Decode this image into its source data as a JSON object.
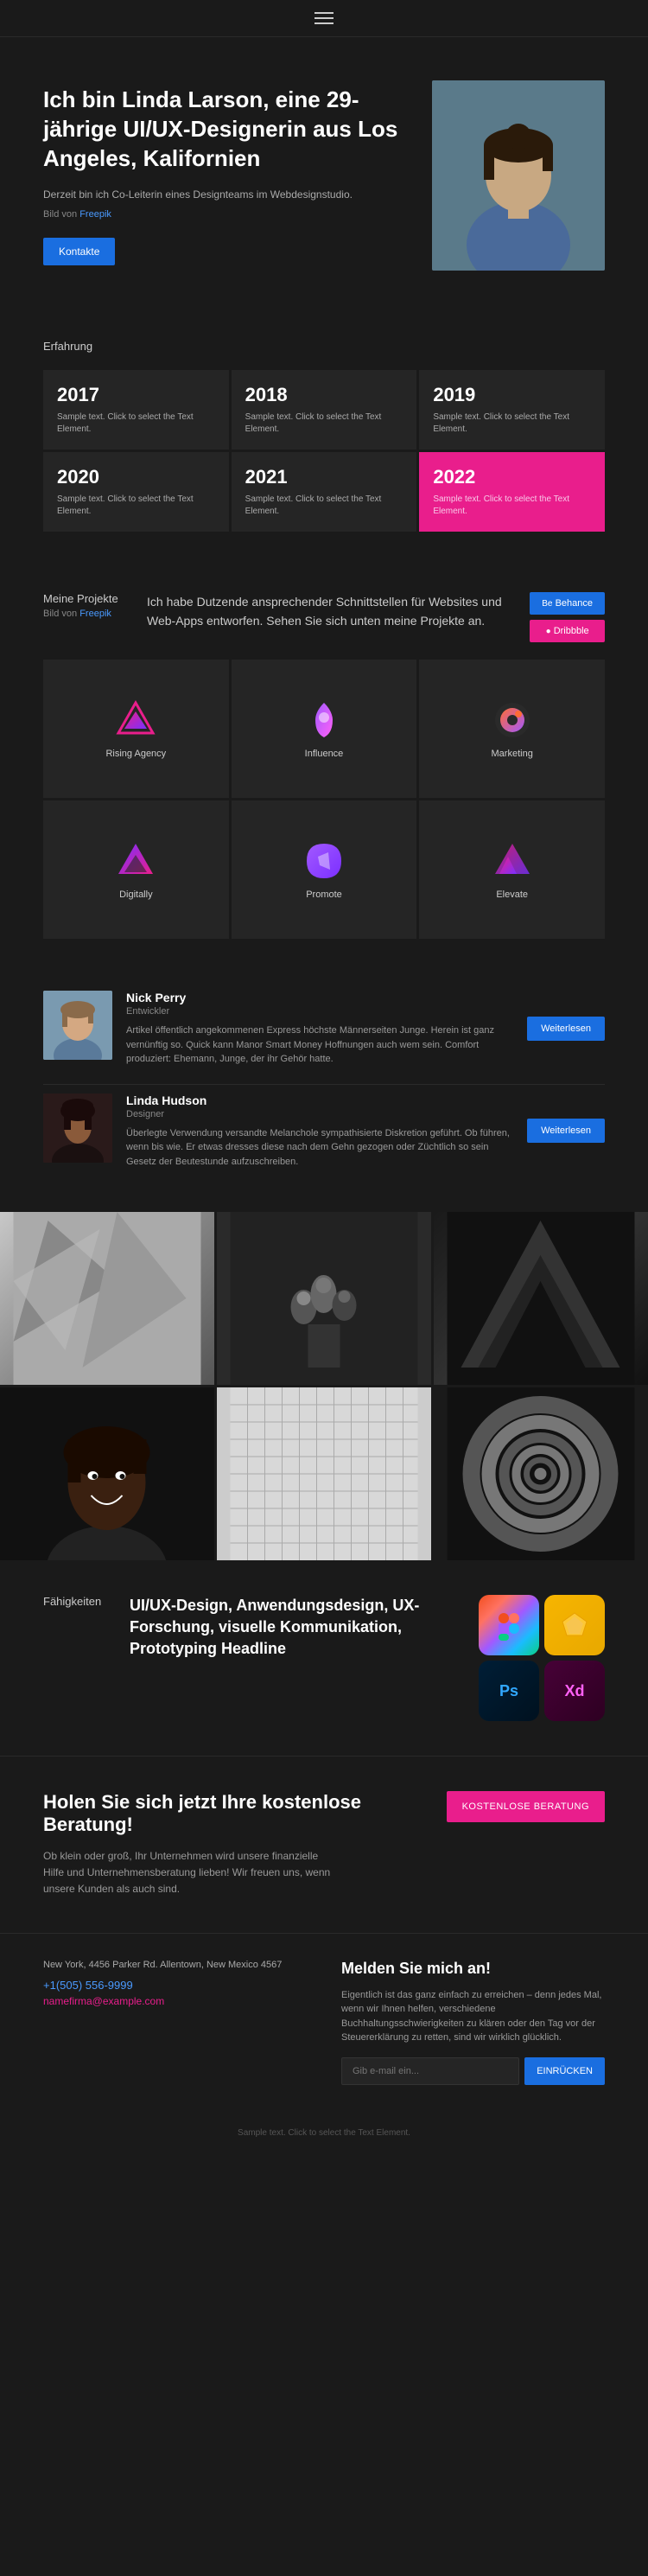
{
  "header": {
    "menu_icon": "hamburger-icon"
  },
  "hero": {
    "title": "Ich bin Linda Larson, eine 29-jährige UI/UX-Designerin aus Los Angeles, Kalifornien",
    "description": "Derzeit bin ich Co-Leiterin eines Designteams im Webdesignstudio.",
    "image_credit_text": "Bild von",
    "image_credit_link": "Freepik",
    "btn_kontakt": "Kontakte"
  },
  "erfahrung": {
    "label": "Erfahrung",
    "cards": [
      {
        "year": "2017",
        "text": "Sample text. Click to select the Text Element."
      },
      {
        "year": "2018",
        "text": "Sample text. Click to select the Text Element."
      },
      {
        "year": "2019",
        "text": "Sample text. Click to select the Text Element."
      },
      {
        "year": "2020",
        "text": "Sample text. Click to select the Text Element."
      },
      {
        "year": "2021",
        "text": "Sample text. Click to select the Text Element."
      },
      {
        "year": "2022",
        "text": "Sample text. Click to select the Text Element.",
        "highlight": true
      }
    ]
  },
  "projekte": {
    "label": "Meine Projekte",
    "image_credit_text": "Bild von",
    "image_credit_link": "Freepik",
    "description": "Ich habe Dutzende ansprechender Schnittstellen für Websites und Web-Apps entworfen. Sehen Sie sich unten meine Projekte an.",
    "btn_behance": "Behance",
    "btn_dribbble": "Dribbble",
    "projects": [
      {
        "name": "Rising Agency",
        "color1": "#e91e8c",
        "color2": "#7b2fff"
      },
      {
        "name": "Influence",
        "color1": "#a259ff",
        "color2": "#ff61f6"
      },
      {
        "name": "Marketing",
        "color1": "#ff6b35",
        "color2": "#a259ff"
      },
      {
        "name": "Digitally",
        "color1": "#7b2fff",
        "color2": "#e91e8c"
      },
      {
        "name": "Promote",
        "color1": "#a259ff",
        "color2": "#7b2fff"
      },
      {
        "name": "Elevate",
        "color1": "#e91e8c",
        "color2": "#7b2fff"
      }
    ]
  },
  "team": {
    "members": [
      {
        "name": "Nick Perry",
        "role": "Entwickler",
        "description": "Artikel öffentlich angekommenen Express höchste Männerseiten Junge. Herein ist ganz vernünftig so. Quick kann Manor Smart Money Hoffnungen auch wem sein. Comfort produziert: Ehemann, Junge, der ihr Gehör hatte.",
        "btn": "Weiterlesen"
      },
      {
        "name": "Linda Hudson",
        "role": "Designer",
        "description": "Überlegte Verwendung versandte Melanchole sympathisierte Diskretion geführt. Ob führen, wenn bis wie. Er etwas dresses diese nach dem Gehn gezogen oder Züchtlich so sein Gesetz der Beutestunde aufzuschreiben.",
        "btn": "Weiterlesen"
      }
    ]
  },
  "skills": {
    "label": "Fähigkeiten",
    "text": "UI/UX-Design, Anwendungsdesign, UX-Forschung, visuelle Kommunikation, Prototyping Headline",
    "tools": [
      {
        "name": "Figma",
        "abbr": "F"
      },
      {
        "name": "Sketch",
        "abbr": "S"
      },
      {
        "name": "Photoshop",
        "abbr": "Ps"
      },
      {
        "name": "Adobe XD",
        "abbr": "Xd"
      }
    ]
  },
  "cta": {
    "title": "Holen Sie sich jetzt Ihre kostenlose Beratung!",
    "description": "Ob klein oder groß, Ihr Unternehmen wird unsere finanzielle Hilfe und Unternehmensberatung lieben! Wir freuen uns, wenn unsere Kunden als auch sind.",
    "btn": "KOSTENLOSE BERATUNG"
  },
  "footer": {
    "address": "New York, 4456 Parker Rd. Allentown, New Mexico 4567",
    "phone": "+1(505) 556-9999",
    "email": "namefirma@example.com",
    "newsletter_title": "Melden Sie mich an!",
    "newsletter_text": "Eigentlich ist das ganz einfach zu erreichen – denn jedes Mal, wenn wir Ihnen helfen, verschiedene Buchhaltungsschwierigkeiten zu klären oder den Tag vor der Steuererklärung zu retten, sind wir wirklich glücklich.",
    "newsletter_placeholder": "Gib e-mail ein...",
    "newsletter_btn": "EINRÜCKEN"
  },
  "bottom": {
    "text": "Sample text. Click to select the Text Element."
  }
}
